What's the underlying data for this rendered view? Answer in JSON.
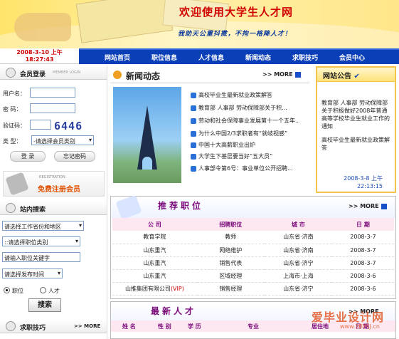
{
  "header": {
    "title": "欢迎使用大学生人才网",
    "slogan": "我助天公重抖擞，不拘一格降人才！"
  },
  "datetime": {
    "date": "2008-3-10 上午",
    "time": "18:27:43"
  },
  "nav": [
    "网站首页",
    "职位信息",
    "人才信息",
    "新闻动态",
    "求职技巧",
    "会员中心"
  ],
  "login": {
    "title": "会员登录",
    "subtitle": "MEMBER LOGIN",
    "username_label": "用户名：",
    "password_label": "密  码：",
    "captcha_label": "验证码：",
    "captcha_value": "6446",
    "type_label": "类  型：",
    "type_select": "-请选择会员类别",
    "login_button": "登 录",
    "forgot_button": "忘记密码"
  },
  "register_banner": {
    "en": "REGISTRATION",
    "cn": "免费注册会员"
  },
  "search": {
    "title": "站内搜索",
    "province_select": "请选择工作省份和地区",
    "category_select": "::请选择职位类别",
    "keyword_placeholder": "请输入职位关键字",
    "time_select": "请选择发布时间",
    "radio_job": "职位",
    "radio_talent": "人才",
    "search_button": "搜索"
  },
  "tips": {
    "title": "求职技巧",
    "more": ">> MORE"
  },
  "news": {
    "title": "新闻动态",
    "more": ">> MORE",
    "items": [
      "高校毕业生最新就业政策解答",
      "教育部 人事部 劳动保障部关于积...",
      "劳动和社会保障事业发展第十一个五年...",
      "为什么中国2/3求职者有“就岐视感”",
      "中国十大高薪职业出炉",
      "大学生下基层要当好“五大员”",
      "人事部令第6号：事业单位公开招聘..."
    ]
  },
  "notice": {
    "title": "网站公告",
    "paragraphs": [
      "教育部 人事部 劳动保障部关于积极做好2008年普通高等学校毕业生就业工作的通知",
      "高校毕业生最新就业政策解答"
    ],
    "date": "2008-3-8 上午",
    "time": "22:13:15"
  },
  "jobs": {
    "title": "推荐职位",
    "more": ">> MORE",
    "columns": [
      "公  司",
      "招聘职位",
      "城  市",
      "日  期"
    ],
    "rows": [
      {
        "company": "教育学院",
        "position": "教师",
        "city": "山东省·济南",
        "date": "2008-3-7",
        "vip": ""
      },
      {
        "company": "山东重汽",
        "position": "网络维护",
        "city": "山东省·济南",
        "date": "2008-3-7",
        "vip": ""
      },
      {
        "company": "山东重汽",
        "position": "销售代表",
        "city": "山东省·济宁",
        "date": "2008-3-7",
        "vip": ""
      },
      {
        "company": "山东重汽",
        "position": "区域经理",
        "city": "上海市·上海",
        "date": "2008-3-6",
        "vip": ""
      },
      {
        "company": "山推集团有限公司",
        "position": "销售经理",
        "city": "山东省·济宁",
        "date": "2008-3-6",
        "vip": "(VIP)"
      }
    ]
  },
  "talents": {
    "title": "最新人才",
    "more": ">> MORE",
    "columns": [
      "姓 名",
      "性 别",
      "学 历",
      "专业",
      "居住地",
      "日 期"
    ]
  },
  "watermark": {
    "cn": "爱毕业设计网",
    "url": "www.2BYSJ.cn"
  },
  "colors": {
    "nav": "#0a3fb8",
    "accent_red": "#d10000",
    "section_purple": "#7a0a7a",
    "notice_border": "#f3c34a"
  }
}
